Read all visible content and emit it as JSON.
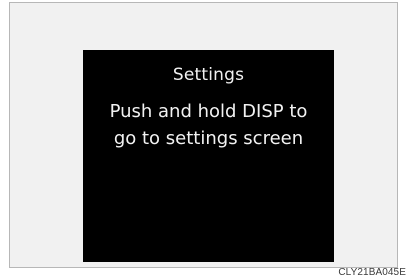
{
  "display": {
    "title": "Settings",
    "message_line1": "Push and hold DISP to",
    "message_line2": "go to settings screen"
  },
  "figure_code": "CLY21BA045E",
  "colors": {
    "frame_background": "#f1f1f1",
    "frame_border": "#b7b7b7",
    "screen_background": "#000000",
    "screen_text": "#f2f2f2"
  }
}
